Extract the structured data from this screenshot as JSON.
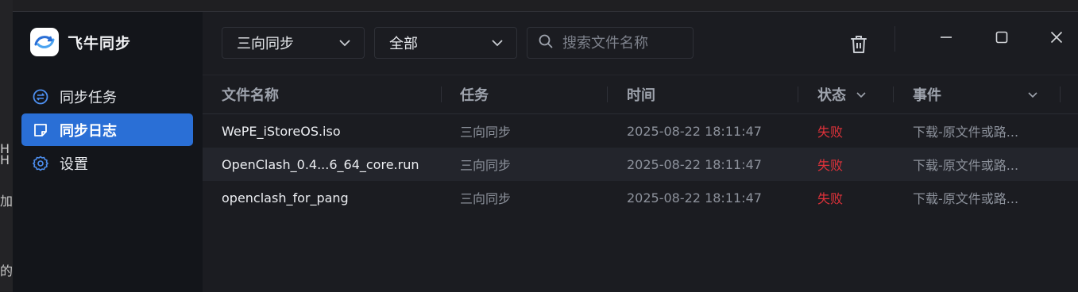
{
  "colors": {
    "accent": "#2a6fd6",
    "danger": "#e0323a",
    "sidebar_bg": "#13151a",
    "window_bg": "#1b1c21"
  },
  "background": {
    "fragments": [
      "H",
      "H",
      "加",
      "的"
    ]
  },
  "app": {
    "name": "飞牛同步",
    "logo_icon": "sync-logo-icon"
  },
  "sidebar": {
    "items": [
      {
        "label": "同步任务",
        "icon": "sync-circle-icon",
        "active": false
      },
      {
        "label": "同步日志",
        "icon": "log-note-icon",
        "active": true
      },
      {
        "label": "设置",
        "icon": "gear-icon",
        "active": false
      }
    ]
  },
  "toolbar": {
    "mode_select": "三向同步",
    "scope_select": "全部",
    "search": {
      "placeholder": "搜索文件名称",
      "value": ""
    },
    "delete_icon": "trash-icon",
    "window": {
      "minimize_icon": "minimize-icon",
      "maximize_icon": "maximize-icon",
      "close_icon": "close-icon"
    }
  },
  "table": {
    "headers": {
      "name": "文件名称",
      "task": "任务",
      "time": "时间",
      "status": "状态",
      "event": "事件"
    },
    "rows": [
      {
        "name": "WePE_iStoreOS.iso",
        "task": "三向同步",
        "time": "2025-08-22 18:11:47",
        "status": "失败",
        "event": "下载-原文件或路..."
      },
      {
        "name": "OpenClash_0.4...6_64_core.run",
        "task": "三向同步",
        "time": "2025-08-22 18:11:47",
        "status": "失败",
        "event": "下载-原文件或路..."
      },
      {
        "name": "openclash_for_pang",
        "task": "三向同步",
        "time": "2025-08-22 18:11:47",
        "status": "失败",
        "event": "下载-原文件或路..."
      }
    ]
  }
}
